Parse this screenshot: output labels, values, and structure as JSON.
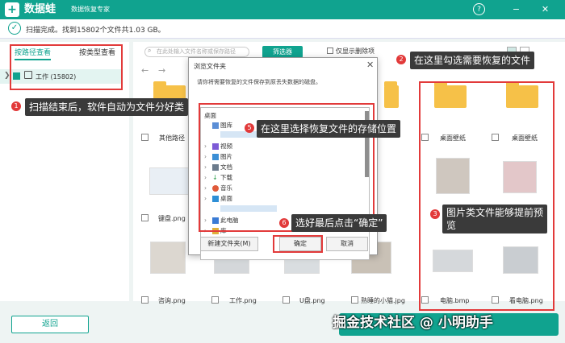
{
  "titlebar": {
    "app_name": "数据蛙",
    "subtitle": "数据恢复专家",
    "logo": "+",
    "help_icon": "?",
    "min_icon": "−",
    "close_icon": "✕"
  },
  "status": {
    "text": "扫描完成。找到15802个文件共1.03 GB。"
  },
  "sidebar": {
    "tab_path": "按路径查看",
    "tab_type": "按类型查看",
    "tree_item": "工作 (15802)"
  },
  "toolbar": {
    "search_placeholder": "在此处输入文件名称或保存路径",
    "filter_button": "筛选器",
    "only_deleted": "仅显示删除项"
  },
  "annotations": {
    "a1": {
      "num": "1",
      "text": "扫描结束后，软件自动为文件分好类"
    },
    "a2": {
      "num": "2",
      "text": "在这里勾选需要恢复的文件"
    },
    "a3": {
      "num": "3",
      "text_line1": "图片类文件能够提前预",
      "text_line2": "览"
    },
    "a5": {
      "num": "5",
      "text": "在这里选择恢复文件的存储位置"
    },
    "a6": {
      "num": "6",
      "text": "选好最后点击“确定”"
    }
  },
  "files": {
    "row1": [
      "其他路径",
      "桌面壁纸",
      "桌面壁纸"
    ],
    "row2": [
      "键盘.png"
    ],
    "row3": [
      "咨询.png",
      "工作.png",
      "U盘.png",
      "熟睡的小猫.jpg",
      "电脑.bmp",
      "看电脑.png"
    ]
  },
  "dialog": {
    "title": "浏览文件夹",
    "close": "✕",
    "description": "请你将需要恢复的文件保存到原丢失数据的磁盘。",
    "tree": [
      "桌面",
      "图库",
      "视频",
      "图片",
      "文档",
      "下载",
      "音乐",
      "桌面",
      "此电脑",
      "库"
    ],
    "new_folder": "新建文件夹(M)",
    "ok": "确定",
    "cancel": "取消"
  },
  "footer": {
    "back": "返回",
    "watermark": "掘金技术社区 @ 小明助手"
  },
  "colors": {
    "accent": "#10a38f",
    "annotation": "#e23a3a",
    "callout_bg": "#3a3a3a"
  }
}
